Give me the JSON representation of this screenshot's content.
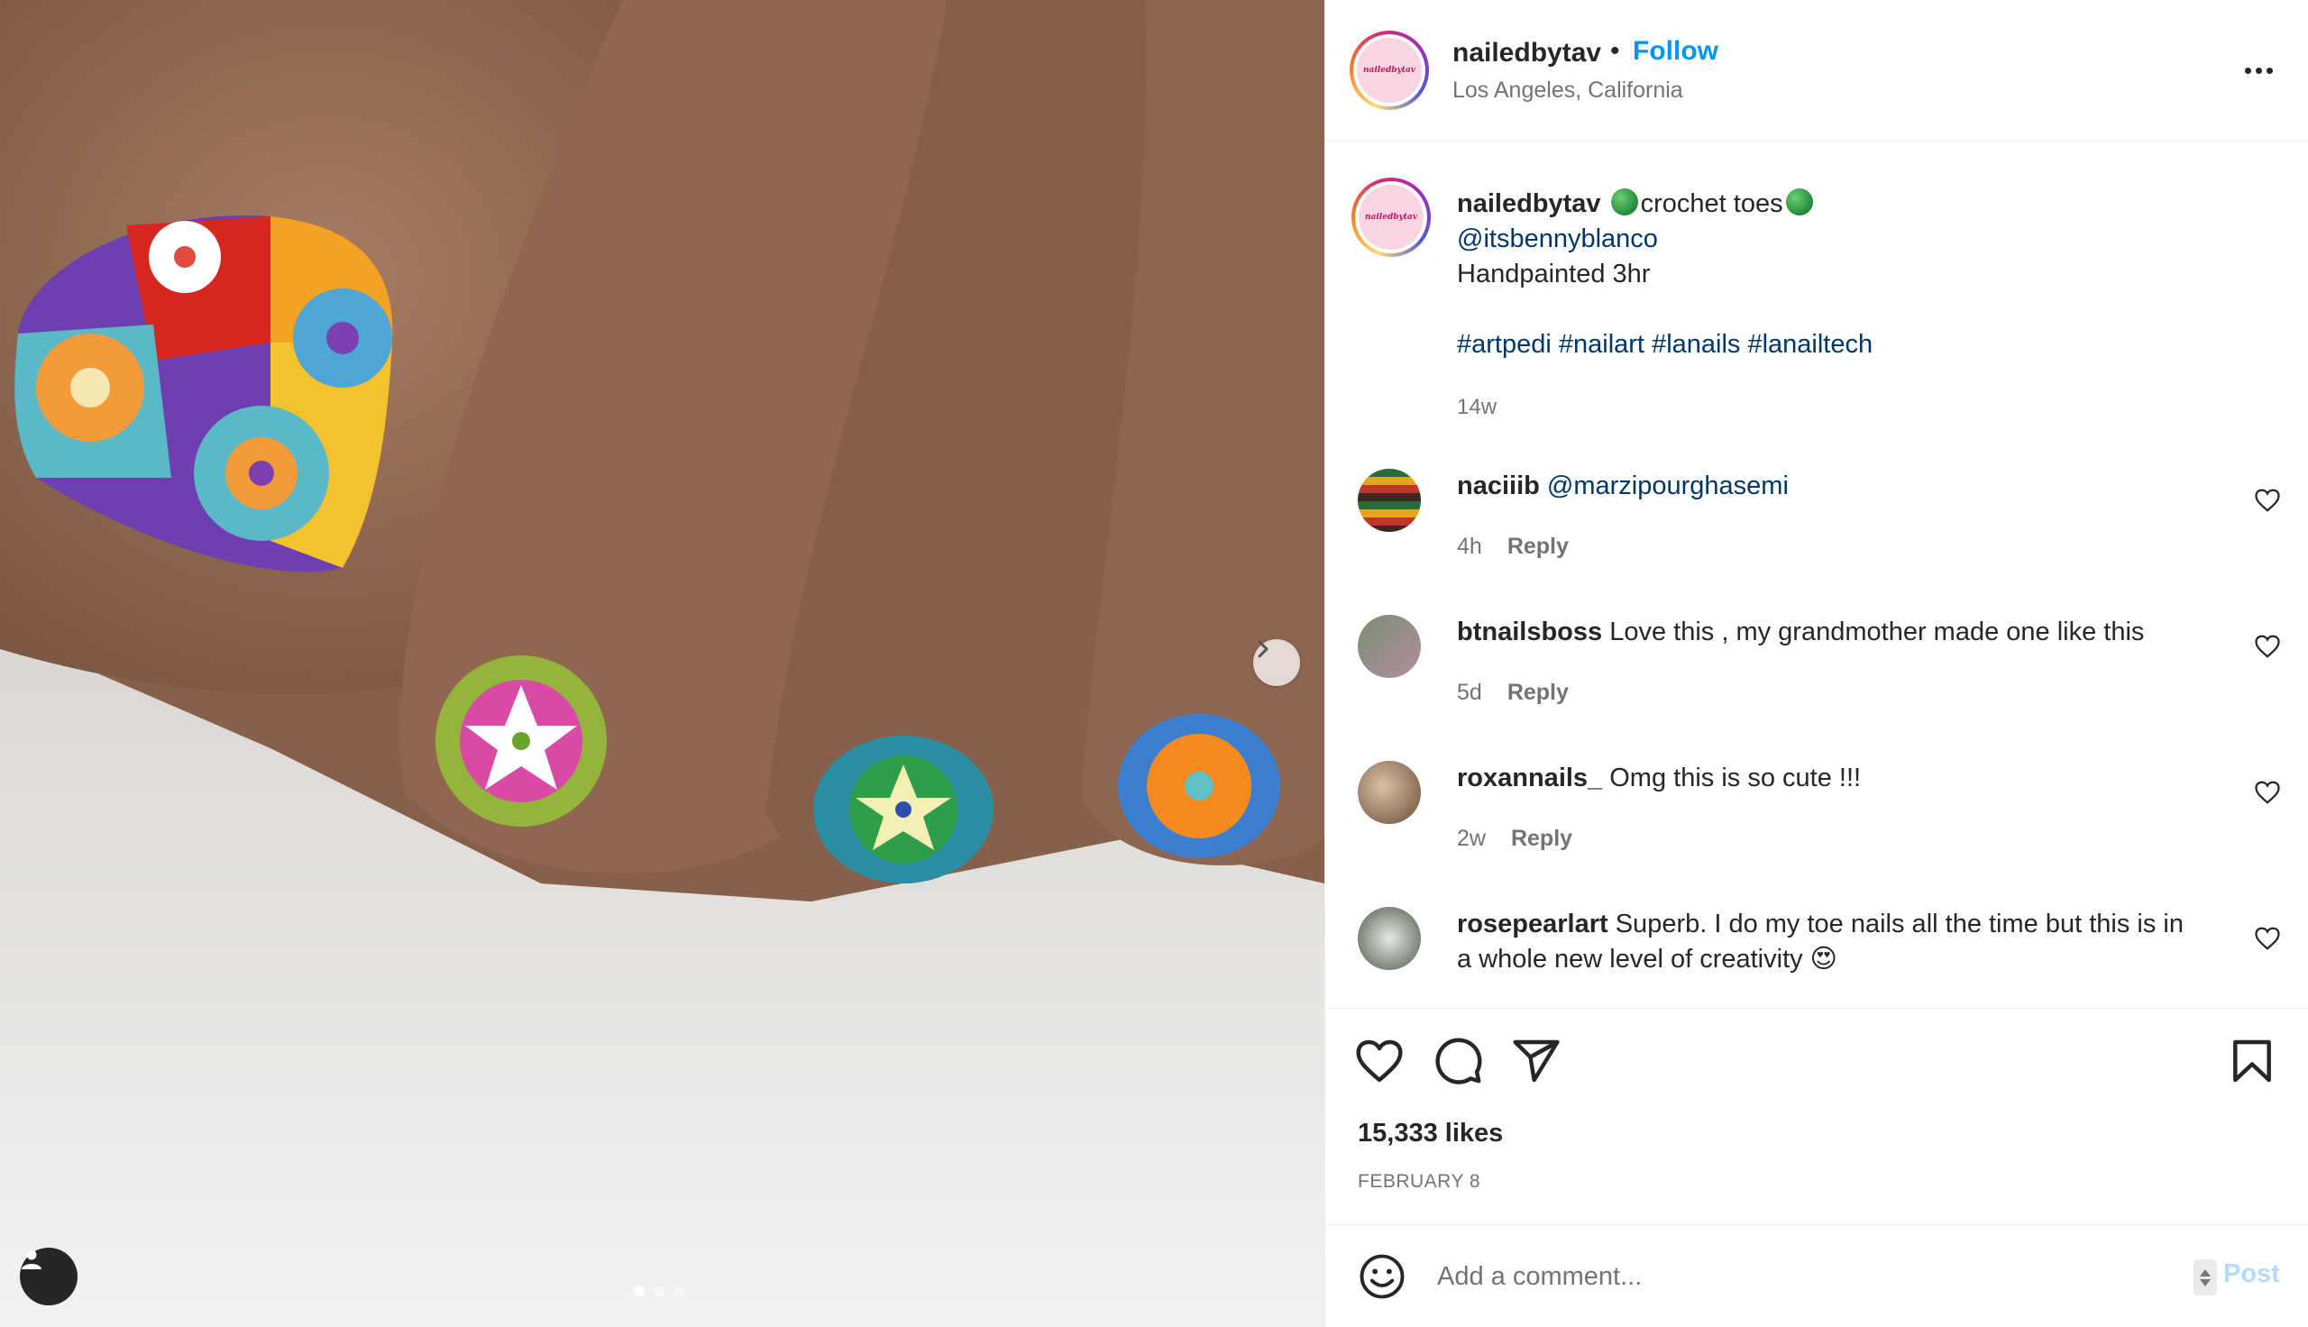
{
  "post": {
    "username": "nailedbytav",
    "location": "Los Angeles, California",
    "follow_label": "Follow",
    "separator": "•",
    "avatar_text": "nailedbytav",
    "caption": {
      "title": "crochet toes",
      "mention": "@itsbennyblanco",
      "line": "Handpainted 3hr",
      "hashtags": [
        "#artpedi",
        "#nailart",
        "#lanails",
        "#lanailtech"
      ],
      "time": "14w"
    },
    "comments": [
      {
        "user": "naciiib",
        "text": "",
        "mention": "@marzipourghasemi",
        "time": "4h",
        "reply": "Reply"
      },
      {
        "user": "btnailsboss",
        "text": "Love this , my grandmother made one like this",
        "time": "5d",
        "reply": "Reply"
      },
      {
        "user": "roxannails_",
        "text": "Omg this is so cute !!!",
        "time": "2w",
        "reply": "Reply"
      },
      {
        "user": "rosepearlart",
        "text": "Superb. I do my toe nails all the time but this is in a whole new level of creativity 😍",
        "time": "",
        "reply": ""
      }
    ],
    "likes": "15,333 likes",
    "date": "FEBRUARY 8",
    "comment_placeholder": "Add a comment...",
    "post_label": "Post",
    "carousel_count": 3,
    "carousel_active": 1
  },
  "colors": {
    "follow": "#0095f6",
    "link": "#00376b",
    "muted": "#737373",
    "post_disabled": "#b3dbff"
  },
  "icons": [
    "next-arrow-icon",
    "user-tag-icon",
    "more-options-icon",
    "heart-icon",
    "comment-icon",
    "share-icon",
    "bookmark-icon",
    "emoji-icon"
  ]
}
